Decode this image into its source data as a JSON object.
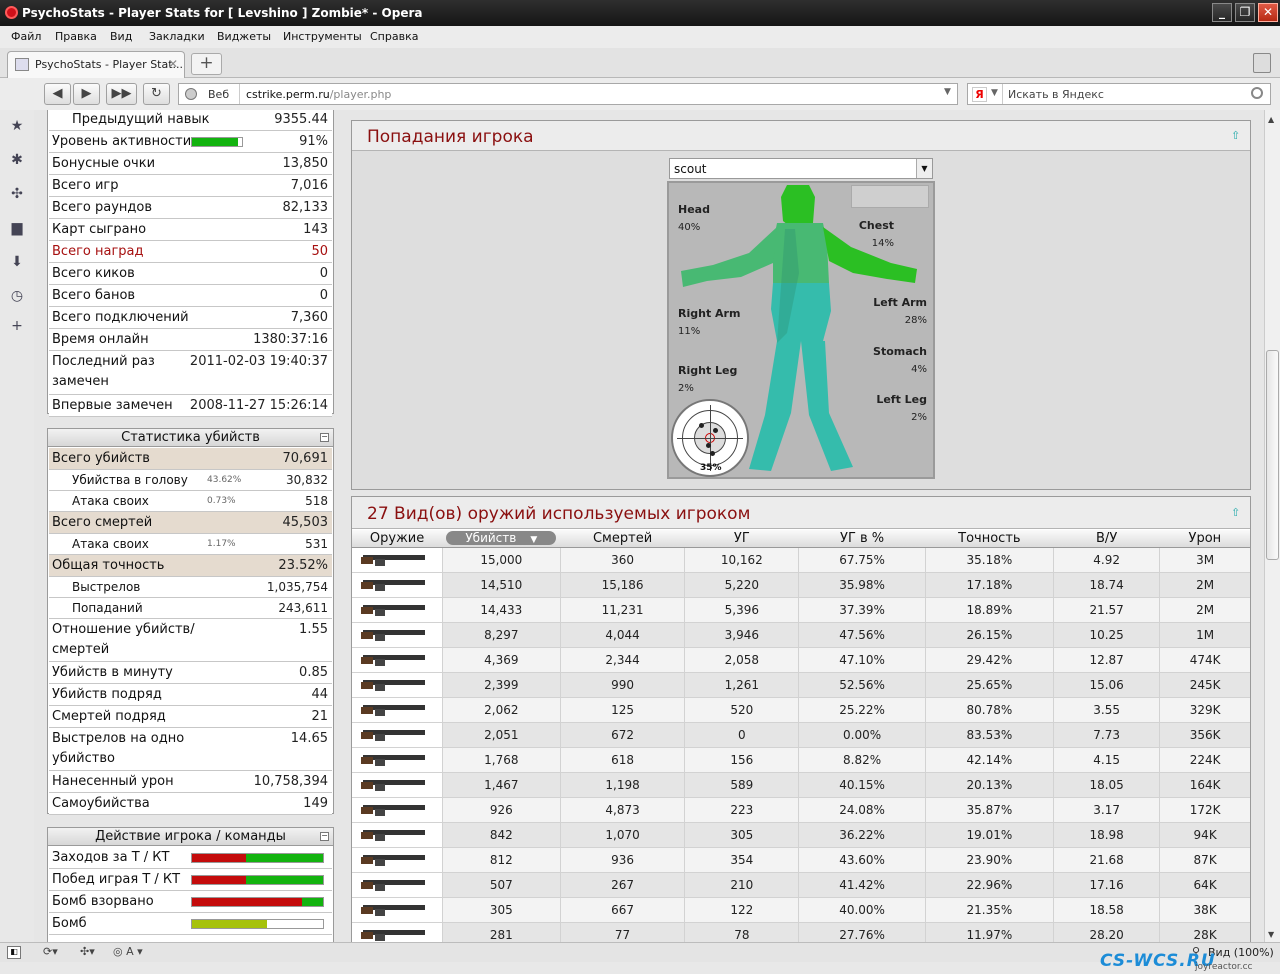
{
  "window": {
    "title": "PsychoStats - Player Stats for [ Levshino ] Zombie* - Opera"
  },
  "menu": [
    "Файл",
    "Правка",
    "Вид",
    "Закладки",
    "Виджеты",
    "Инструменты",
    "Справка"
  ],
  "tab": {
    "title": "PsychoStats - Player Stat...",
    "close": "✕",
    "new_tab": "+"
  },
  "address": {
    "mode": "Веб",
    "host": "cstrike.perm.ru",
    "path": "/player.php"
  },
  "search": {
    "engine": "Я",
    "placeholder": "Искать в Яндекс"
  },
  "player_stats": [
    {
      "label": "Предыдущий навык",
      "value": "9355.44",
      "indent": true
    },
    {
      "label": "Уровень активности",
      "value": "91%",
      "activity": 0.91
    },
    {
      "label": "Бонусные очки",
      "value": "13,850"
    },
    {
      "label": "Всего игр",
      "value": "7,016"
    },
    {
      "label": "Всего раундов",
      "value": "82,133"
    },
    {
      "label": "Карт сыграно",
      "value": "143"
    },
    {
      "label": "Всего наград",
      "value": "50",
      "red": true
    },
    {
      "label": "Всего киков",
      "value": "0"
    },
    {
      "label": "Всего банов",
      "value": "0"
    },
    {
      "label": "Всего подключений",
      "value": "7,360"
    },
    {
      "label": "Время онлайн",
      "value": "1380:37:16"
    },
    {
      "label": "Последний раз",
      "label2": "замечен",
      "value": "2011-02-03 19:40:37"
    },
    {
      "label": "Впервые замечен",
      "value": "2008-11-27 15:26:14"
    }
  ],
  "kill_stats": {
    "title": "Статистика убийств",
    "min": "−",
    "rows": [
      {
        "label": "Всего убийств",
        "value": "70,691",
        "hl": true
      },
      {
        "label": "Убийства в голову",
        "pct": "43.62%",
        "value": "30,832",
        "sub": true
      },
      {
        "label": "Атака своих",
        "pct": "0.73%",
        "value": "518",
        "sub": true
      },
      {
        "label": "Всего смертей",
        "value": "45,503",
        "hl": true
      },
      {
        "label": "Атака своих",
        "pct": "1.17%",
        "value": "531",
        "sub": true
      },
      {
        "label": "Общая точность",
        "value": "23.52%",
        "hl": true
      },
      {
        "label": "Выстрелов",
        "value": "1,035,754",
        "sub": true
      },
      {
        "label": "Попаданий",
        "value": "243,611",
        "sub": true
      },
      {
        "label": "Отношение убийств/",
        "label2": "смертей",
        "value": "1.55"
      },
      {
        "label": "Убийств в минуту",
        "value": "0.85"
      },
      {
        "label": "Убийств подряд",
        "value": "44"
      },
      {
        "label": "Смертей подряд",
        "value": "21"
      },
      {
        "label": "Выстрелов на одно",
        "label2": "убийство",
        "value": "14.65"
      },
      {
        "label": "Нанесенный урон",
        "value": "10,758,394"
      },
      {
        "label": "Самоубийства",
        "value": "149"
      }
    ]
  },
  "team_actions": {
    "title": "Действие игрока / команды",
    "min": "−",
    "rows": [
      {
        "label": "Заходов за Т / КТ",
        "t": 0.41,
        "ct": 0.59
      },
      {
        "label": "Побед играя Т / КТ",
        "t": 0.41,
        "ct": 0.59
      },
      {
        "label": "Бомб взорвано",
        "t": 0.84,
        "ct": 0.16
      },
      {
        "label": "Бомб",
        "t": 0.57,
        "ct": 0
      }
    ],
    "colors": {
      "t": "#c40c0c",
      "ct": "#13b30f",
      "bomb": "#a6c20b"
    }
  },
  "hits": {
    "title": "Попадания игрока",
    "weapon": "scout",
    "parts": [
      {
        "name": "Head",
        "pct": "40%"
      },
      {
        "name": "Chest",
        "pct": "14%"
      },
      {
        "name": "Right Arm",
        "pct": "11%"
      },
      {
        "name": "Left Arm",
        "pct": "28%"
      },
      {
        "name": "Stomach",
        "pct": "4%"
      },
      {
        "name": "Right Leg",
        "pct": "2%"
      },
      {
        "name": "Left Leg",
        "pct": "2%"
      }
    ],
    "target_pct": "35%"
  },
  "weapons": {
    "title": "27 Вид(ов) оружий используемых игроком",
    "headers": [
      "Оружие",
      "Убийств",
      "Смертей",
      "УГ",
      "УГ в %",
      "Точность",
      "В/У",
      "Урон"
    ],
    "rows": [
      [
        "15,000",
        "360",
        "10,162",
        "67.75%",
        "35.18%",
        "4.92",
        "3M"
      ],
      [
        "14,510",
        "15,186",
        "5,220",
        "35.98%",
        "17.18%",
        "18.74",
        "2M"
      ],
      [
        "14,433",
        "11,231",
        "5,396",
        "37.39%",
        "18.89%",
        "21.57",
        "2M"
      ],
      [
        "8,297",
        "4,044",
        "3,946",
        "47.56%",
        "26.15%",
        "10.25",
        "1M"
      ],
      [
        "4,369",
        "2,344",
        "2,058",
        "47.10%",
        "29.42%",
        "12.87",
        "474K"
      ],
      [
        "2,399",
        "990",
        "1,261",
        "52.56%",
        "25.65%",
        "15.06",
        "245K"
      ],
      [
        "2,062",
        "125",
        "520",
        "25.22%",
        "80.78%",
        "3.55",
        "329K"
      ],
      [
        "2,051",
        "672",
        "0",
        "0.00%",
        "83.53%",
        "7.73",
        "356K"
      ],
      [
        "1,768",
        "618",
        "156",
        "8.82%",
        "42.14%",
        "4.15",
        "224K"
      ],
      [
        "1,467",
        "1,198",
        "589",
        "40.15%",
        "20.13%",
        "18.05",
        "164K"
      ],
      [
        "926",
        "4,873",
        "223",
        "24.08%",
        "35.87%",
        "3.17",
        "172K"
      ],
      [
        "842",
        "1,070",
        "305",
        "36.22%",
        "19.01%",
        "18.98",
        "94K"
      ],
      [
        "812",
        "936",
        "354",
        "43.60%",
        "23.90%",
        "21.68",
        "87K"
      ],
      [
        "507",
        "267",
        "210",
        "41.42%",
        "22.96%",
        "17.16",
        "64K"
      ],
      [
        "305",
        "667",
        "122",
        "40.00%",
        "21.35%",
        "18.58",
        "38K"
      ],
      [
        "281",
        "77",
        "78",
        "27.76%",
        "11.97%",
        "28.20",
        "28K"
      ]
    ]
  },
  "status": {
    "zoom": "Вид (100%)"
  },
  "watermark": {
    "text": "CS-WCS.RU",
    "sub": "joyreactor.cc"
  }
}
